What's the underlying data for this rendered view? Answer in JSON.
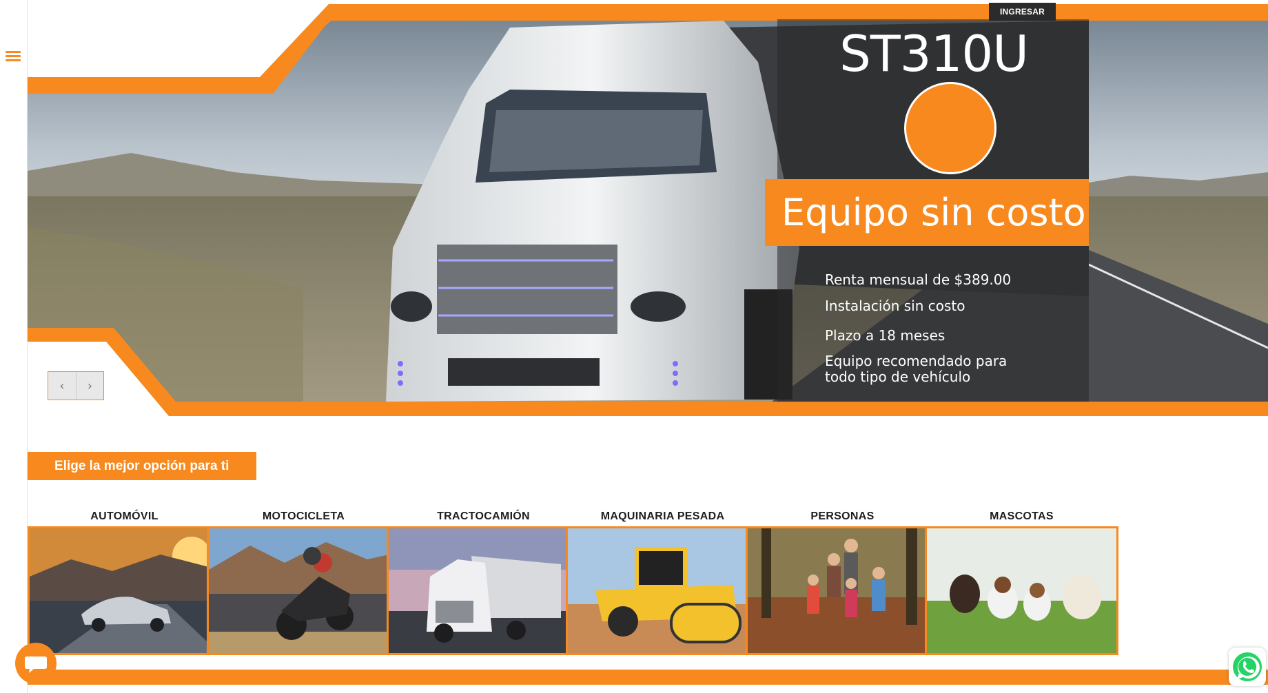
{
  "header": {
    "login_label": "INGRESAR",
    "menu_icon": "hamburger-icon"
  },
  "hero": {
    "product_name": "ST310U",
    "headline": "Equipo sin costo",
    "features": [
      "Renta mensual de $389.00",
      "Instalación sin costo",
      "Plazo a 18 meses",
      "Equipo recomendado para todo tipo de vehículo"
    ],
    "prev_label": "‹",
    "next_label": "›"
  },
  "section": {
    "title": "Elige la mejor opción para ti"
  },
  "categories": [
    {
      "label": "AUTOMÓVIL",
      "image": "car-photo"
    },
    {
      "label": "MOTOCICLETA",
      "image": "motorcycle-photo"
    },
    {
      "label": "TRACTOCAMIÓN",
      "image": "truck-photo"
    },
    {
      "label": "MAQUINARIA PESADA",
      "image": "road-roller-photo"
    },
    {
      "label": "PERSONAS",
      "image": "family-photo"
    },
    {
      "label": "MASCOTAS",
      "image": "dogs-photo"
    }
  ],
  "widgets": {
    "chat_icon": "chat-bubble-icon",
    "whatsapp_icon": "whatsapp-icon"
  },
  "colors": {
    "brand_orange": "#f7891f",
    "dark": "#2b2b2b"
  }
}
